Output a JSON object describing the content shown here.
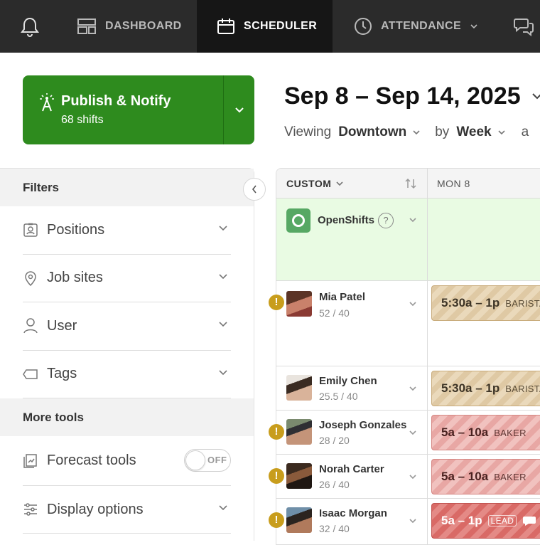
{
  "nav": {
    "items": [
      {
        "label": "DASHBOARD",
        "icon": "dashboard-icon"
      },
      {
        "label": "SCHEDULER",
        "icon": "calendar-icon",
        "active": true
      },
      {
        "label": "ATTENDANCE",
        "icon": "clock-icon"
      }
    ]
  },
  "publish": {
    "title": "Publish & Notify",
    "subtitle": "68 shifts"
  },
  "header": {
    "date_range": "Sep 8 – Sep 14, 2025",
    "viewing_label": "Viewing",
    "location": "Downtown",
    "by_label": "by",
    "period": "Week",
    "trailing": "a"
  },
  "sidebar": {
    "filters_title": "Filters",
    "filters": [
      {
        "label": "Positions",
        "icon": "id-badge-icon"
      },
      {
        "label": "Job sites",
        "icon": "map-pin-icon"
      },
      {
        "label": "User",
        "icon": "user-icon"
      },
      {
        "label": "Tags",
        "icon": "tag-icon"
      }
    ],
    "more_tools_title": "More tools",
    "forecast_label": "Forecast tools",
    "forecast_toggle": "OFF",
    "display_label": "Display options"
  },
  "grid": {
    "sort_label": "CUSTOM",
    "day_label": "MON 8",
    "open_shifts_label": "OpenShifts",
    "users": [
      {
        "name": "Mia Patel",
        "hours": "52 / 40",
        "warning": true,
        "shift_time": "5:30a – 1p",
        "shift_position": "BARISTA"
      },
      {
        "name": "Emily Chen",
        "hours": "25.5 / 40",
        "warning": false,
        "shift_time": "5:30a – 1p",
        "shift_position": "BARISTA"
      },
      {
        "name": "Joseph Gonzales",
        "hours": "28 / 20",
        "warning": true,
        "shift_time": "5a – 10a",
        "shift_position": "BAKER"
      },
      {
        "name": "Norah Carter",
        "hours": "26 / 40",
        "warning": true,
        "shift_time": "5a – 10a",
        "shift_position": "BAKER"
      },
      {
        "name": "Isaac Morgan",
        "hours": "32 / 40",
        "warning": true,
        "shift_time": "5a – 1p",
        "shift_position": "LEAD"
      }
    ]
  },
  "colors": {
    "publish_green": "#2e8b1e",
    "open_row": "#e9fbe3",
    "warning": "#c89d1c",
    "barista": "#dfc9a4",
    "baker": "#e8a7a4",
    "lead": "#d96a66"
  }
}
